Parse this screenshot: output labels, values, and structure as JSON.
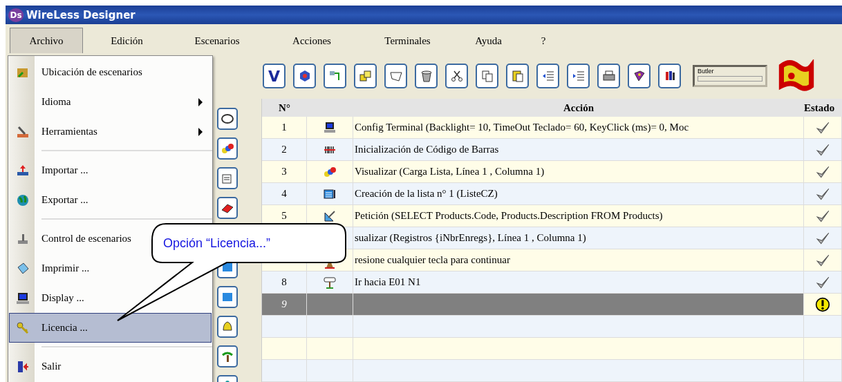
{
  "window": {
    "logo": "Ds",
    "title": "WireLess Designer"
  },
  "menubar": [
    {
      "label": "Archivo",
      "selected": true
    },
    {
      "label": "Edición",
      "selected": false
    },
    {
      "label": "Escenarios",
      "selected": false
    },
    {
      "label": "Acciones",
      "selected": false
    },
    {
      "label": "Terminales",
      "selected": false
    },
    {
      "label": "Ayuda",
      "selected": false
    },
    {
      "label": "?",
      "selected": false
    }
  ],
  "menu": [
    {
      "kind": "item",
      "label": "Ubicación de escenarios",
      "icon": true,
      "submenu": false,
      "selected": false
    },
    {
      "kind": "item",
      "label": "Idioma",
      "icon": false,
      "submenu": true,
      "selected": false
    },
    {
      "kind": "item",
      "label": "Herramientas",
      "icon": true,
      "submenu": true,
      "selected": false
    },
    {
      "kind": "separator"
    },
    {
      "kind": "item",
      "label": "Importar ...",
      "icon": true,
      "submenu": false,
      "selected": false
    },
    {
      "kind": "item",
      "label": "Exportar ...",
      "icon": true,
      "submenu": false,
      "selected": false
    },
    {
      "kind": "separator"
    },
    {
      "kind": "item",
      "label": "Control de escenarios",
      "icon": true,
      "submenu": false,
      "selected": false
    },
    {
      "kind": "item",
      "label": "Imprimir ...",
      "icon": true,
      "submenu": false,
      "selected": false
    },
    {
      "kind": "item",
      "label": "Display ...",
      "icon": true,
      "submenu": false,
      "selected": false
    },
    {
      "kind": "item",
      "label": "Licencia ...",
      "icon": true,
      "submenu": false,
      "selected": true
    },
    {
      "kind": "separator"
    },
    {
      "kind": "item",
      "label": "Salir",
      "icon": true,
      "submenu": false,
      "selected": false
    }
  ],
  "toolbar": {
    "first_button": "V",
    "status_label": "Butler"
  },
  "table": {
    "columns": [
      "N°",
      "Acción",
      "Estado"
    ],
    "rows": [
      {
        "number": "1",
        "kind": "terminal",
        "action": "Config Terminal (Backlight= 10, TimeOut Teclado= 60, KeyClick (ms)= 0, Moc",
        "done": true,
        "warning": false,
        "selected": false
      },
      {
        "number": "2",
        "kind": "barcode",
        "action": "Inicialización de Código de Barras",
        "done": true,
        "warning": false,
        "selected": false
      },
      {
        "number": "3",
        "kind": "display",
        "action": "Visualizar (Carga Lista, Línea 1 , Columna 1)",
        "done": true,
        "warning": false,
        "selected": false
      },
      {
        "number": "4",
        "kind": "list",
        "action": "Creación de la lista n° 1 (ListeCZ)",
        "done": true,
        "warning": false,
        "selected": false
      },
      {
        "number": "5",
        "kind": "query",
        "action": "Petición (SELECT Products.Code, Products.Description FROM Products)",
        "done": true,
        "warning": false,
        "selected": false
      },
      {
        "number": "",
        "kind": "hidden",
        "action": "sualizar (Registros {iNbrEnregs}, Línea 1 , Columna 1)",
        "done": true,
        "warning": false,
        "selected": false
      },
      {
        "number": "",
        "kind": "pause",
        "action": "resione cualquier tecla para continuar",
        "done": true,
        "warning": false,
        "selected": false
      },
      {
        "number": "8",
        "kind": "goto",
        "action": "Ir hacia E01 N1",
        "done": true,
        "warning": false,
        "selected": false
      },
      {
        "number": "9",
        "kind": "empty",
        "action": "",
        "done": false,
        "warning": true,
        "selected": true
      },
      {
        "number": "",
        "kind": "empty",
        "action": "",
        "done": false,
        "warning": false,
        "selected": false
      },
      {
        "number": "",
        "kind": "empty",
        "action": "",
        "done": false,
        "warning": false,
        "selected": false
      },
      {
        "number": "",
        "kind": "empty",
        "action": "",
        "done": false,
        "warning": false,
        "selected": false
      }
    ]
  },
  "callout": {
    "text": "Opción “Licencia...”"
  }
}
